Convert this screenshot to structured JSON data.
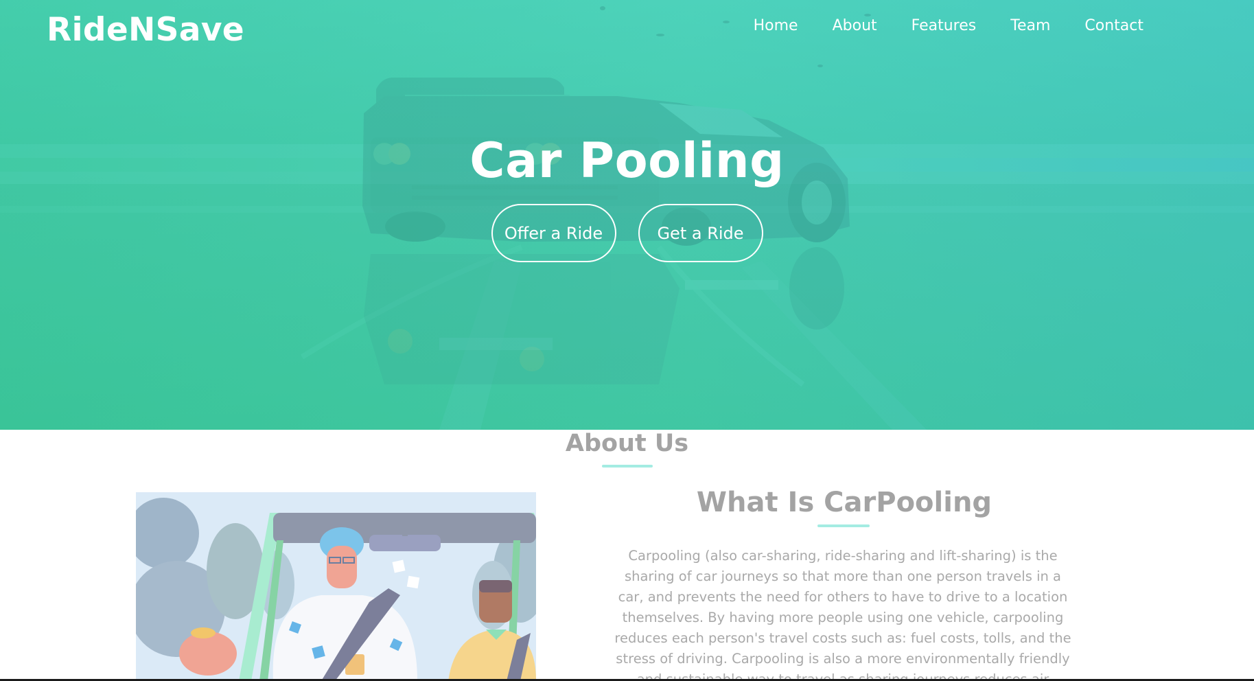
{
  "brand": "RideNSave",
  "nav": {
    "items": [
      "Home",
      "About",
      "Features",
      "Team",
      "Contact"
    ]
  },
  "hero": {
    "title": "Car Pooling",
    "buttons": {
      "offer": "Offer a Ride",
      "get": "Get a Ride"
    }
  },
  "about": {
    "title": "About Us",
    "subtitle": "What Is CarPooling",
    "text": "Carpooling (also car-sharing, ride-sharing and lift-sharing) is the sharing of car journeys so that more than one person travels in a car, and prevents the need for others to have to drive to a location themselves. By having more people using one vehicle, carpooling reduces each person's travel costs such as: fuel costs, tolls, and the stress of driving. Carpooling is also a more environmentally friendly and sustainable way to travel as sharing journeys reduces air pollution, carbon emissions, traffic congestion on the"
  },
  "colors": {
    "gradient_start": "#33c48f",
    "gradient_end": "#3cbfc6",
    "accent_underline": "#a4ece2",
    "heading_gray": "#a3a3a3",
    "text_gray": "#a9a9a9"
  }
}
